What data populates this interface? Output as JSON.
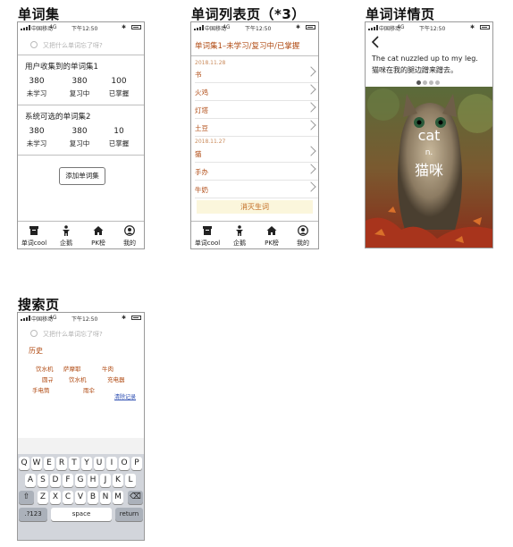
{
  "sections": {
    "wordbook": "单词集",
    "list": "单词列表页（*3）",
    "detail": "单词详情页",
    "search": "搜索页"
  },
  "status_bar": {
    "carrier": "中国移动",
    "network": "4G",
    "time": "下午12:50"
  },
  "wordbook_screen": {
    "search_placeholder": "又把什么单词忘了呀?",
    "user_set": {
      "title": "用户收集到的单词集1",
      "stats": [
        {
          "value": "380",
          "label": "未学习"
        },
        {
          "value": "380",
          "label": "复习中"
        },
        {
          "value": "100",
          "label": "已掌握"
        }
      ]
    },
    "system_set": {
      "title": "系统可选的单词集2",
      "stats": [
        {
          "value": "380",
          "label": "未学习"
        },
        {
          "value": "380",
          "label": "复习中"
        },
        {
          "value": "10",
          "label": "已掌握"
        }
      ]
    },
    "add_button": "添加单词集"
  },
  "tabbar": [
    {
      "label": "单词cool",
      "icon": "box-icon"
    },
    {
      "label": "企鹅",
      "icon": "person-icon"
    },
    {
      "label": "PK榜",
      "icon": "home-icon"
    },
    {
      "label": "我的",
      "icon": "user-icon"
    }
  ],
  "list_screen": {
    "header": "单词集1–未学习/复习中/已掌握",
    "dates": [
      "2018.11.28",
      "2018.11.27"
    ],
    "group1": [
      "书",
      "火鸡",
      "灯塔",
      "土豆"
    ],
    "group2": [
      "猫",
      "手办",
      "牛奶"
    ],
    "action": "消灭生词"
  },
  "detail_screen": {
    "sentence_en": "The cat nuzzled up to my leg.",
    "sentence_zh": "猫咪在我的腿边蹭来蹭去。",
    "word": "cat",
    "pos": "n.",
    "meaning": "猫咪"
  },
  "search_screen": {
    "placeholder": "又把什么单词忘了呀?",
    "history_title": "历史",
    "history": [
      "饮水机",
      "萨摩耶",
      "牛肉",
      "圆규",
      "饮水机",
      "充电器",
      "手电筒",
      "雨伞"
    ],
    "clear": "清除记录"
  },
  "keyboard": {
    "row1": [
      "Q",
      "W",
      "E",
      "R",
      "T",
      "Y",
      "U",
      "I",
      "O",
      "P"
    ],
    "row2": [
      "A",
      "S",
      "D",
      "F",
      "G",
      "H",
      "J",
      "K",
      "L"
    ],
    "row3": [
      "Z",
      "X",
      "C",
      "V",
      "B",
      "N",
      "M"
    ],
    "numbers": ".?123",
    "space": "space",
    "return": "return"
  }
}
